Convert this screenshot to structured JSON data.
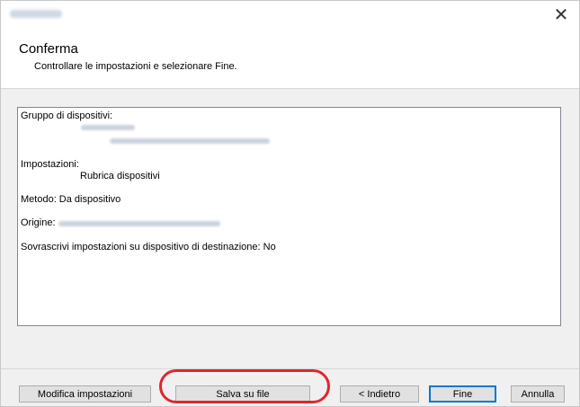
{
  "window": {
    "close_glyph": "✕"
  },
  "header": {
    "title": "Conferma",
    "subtitle": "Controllare le impostazioni e selezionare Fine."
  },
  "summary": {
    "group_label": "Gruppo di dispositivi:",
    "settings_label": "Impostazioni:",
    "settings_value": "Rubrica dispositivi",
    "method": "Metodo: Da dispositivo",
    "origin_label": "Origine:",
    "overwrite": "Sovrascrivi impostazioni su dispositivo di destinazione: No"
  },
  "buttons": {
    "modify": "Modifica impostazioni",
    "save": "Salva su file",
    "back": "< Indietro",
    "finish": "Fine",
    "cancel": "Annulla"
  },
  "colors": {
    "highlight": "#e0262b",
    "primary_border": "#0078d7",
    "dialog_bg": "#f0f0f0"
  },
  "icons": [
    "close-icon"
  ]
}
